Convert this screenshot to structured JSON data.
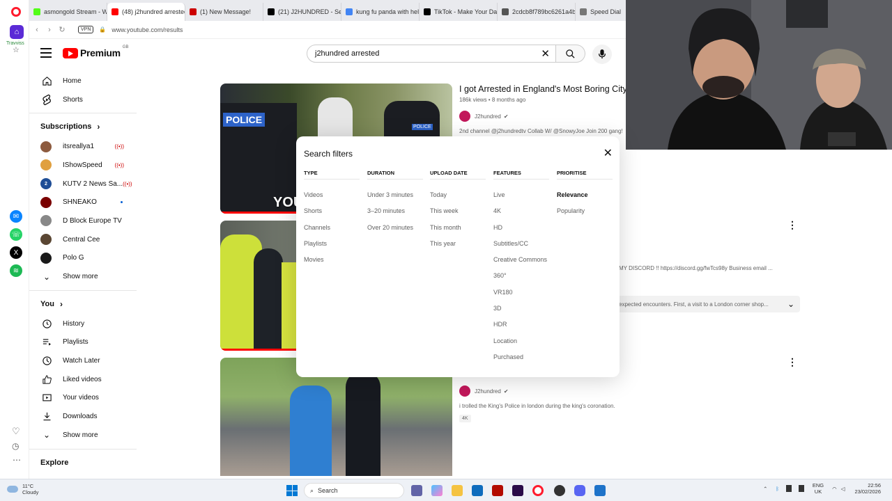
{
  "tabs": [
    {
      "label": "asmongold Stream - Watc",
      "color": "#53fc18"
    },
    {
      "label": "(48) j2hundred arrested -",
      "color": "#ff0000",
      "active": true
    },
    {
      "label": "(1) New Message!",
      "color": "#cc0000"
    },
    {
      "label": "(21) J2HUNDRED - Search",
      "color": "#000000"
    },
    {
      "label": "kung fu panda with helme",
      "color": "#4285f4"
    },
    {
      "label": "TikTok - Make Your Day",
      "color": "#000000"
    },
    {
      "label": "2cdcb8f789bc6261a4ba2",
      "color": "#555555"
    },
    {
      "label": "Speed Dial",
      "color": "#777777"
    }
  ],
  "browser": {
    "url_host": "www.youtube.com",
    "url_path": "/results",
    "vpn_label": "VPN",
    "sidebar_top_label": "Travviss"
  },
  "youtube": {
    "logo_text": "Premium",
    "region": "GB",
    "search_value": "j2hundred arrested"
  },
  "guide": {
    "main": [
      {
        "label": "Home",
        "icon": "home-icon"
      },
      {
        "label": "Shorts",
        "icon": "shorts-icon"
      }
    ],
    "subscriptions_title": "Subscriptions",
    "subscriptions": [
      {
        "label": "itsreallya1",
        "status": "live",
        "color": "#8d5b3f"
      },
      {
        "label": "IShowSpeed",
        "status": "live",
        "color": "#e0a040"
      },
      {
        "label": "KUTV 2 News Sa...",
        "status": "live",
        "color": "#1f4e96",
        "badge": "2"
      },
      {
        "label": "SHNEAKO",
        "status": "new",
        "color": "#7a0000"
      },
      {
        "label": "D Block Europe TV",
        "status": "",
        "color": "#888888"
      },
      {
        "label": "Central Cee",
        "status": "",
        "color": "#5a4633"
      },
      {
        "label": "Polo G",
        "status": "",
        "color": "#1a1a1a"
      }
    ],
    "show_more_1": "Show more",
    "you_title": "You",
    "you_items": [
      {
        "label": "History",
        "icon": "history-icon"
      },
      {
        "label": "Playlists",
        "icon": "playlists-icon"
      },
      {
        "label": "Watch Later",
        "icon": "watch-later-icon"
      },
      {
        "label": "Liked videos",
        "icon": "thumbs-up-icon"
      },
      {
        "label": "Your videos",
        "icon": "your-videos-icon"
      },
      {
        "label": "Downloads",
        "icon": "download-icon"
      }
    ],
    "show_more_2": "Show more",
    "explore_title": "Explore"
  },
  "results": [
    {
      "title": "I got Arrested in England's Most Boring City!",
      "meta": "186k views • 8 months ago",
      "channel": "J2hundred",
      "desc": "2nd channel @j2hundredtv Collab W/ @SnowyJoe Join 200 gang!",
      "thumb_text_1": "POLICE",
      "thumb_text_2": "POLICE",
      "thumb_text_3": "YOU"
    },
    {
      "desc_partial": "MY DISCORD !! https://discord.gg/fwTcs98y Business email ...",
      "chapters_partial": "expected encounters. First, a visit to a London corner shop..."
    },
    {
      "channel": "J2hundred",
      "desc": "i trolled the King's Police in london during the king's coronation.",
      "badge": "4K"
    }
  ],
  "filters": {
    "title": "Search filters",
    "columns": [
      {
        "header": "Type",
        "options": [
          "Videos",
          "Shorts",
          "Channels",
          "Playlists",
          "Movies"
        ]
      },
      {
        "header": "Duration",
        "options": [
          "Under 3 minutes",
          "3–20 minutes",
          "Over 20 minutes"
        ]
      },
      {
        "header": "Upload date",
        "options": [
          "Today",
          "This week",
          "This month",
          "This year"
        ]
      },
      {
        "header": "Features",
        "options": [
          "Live",
          "4K",
          "HD",
          "Subtitles/CC",
          "Creative Commons",
          "360°",
          "VR180",
          "3D",
          "HDR",
          "Location",
          "Purchased"
        ]
      },
      {
        "header": "Prioritise",
        "options": [
          "Relevance",
          "Popularity"
        ],
        "selected": "Relevance"
      }
    ]
  },
  "taskbar": {
    "temp": "11°C",
    "weather": "Cloudy",
    "search_placeholder": "Search",
    "lang_1": "ENG",
    "lang_2": "UK",
    "time": "22:56",
    "date": "23/02/2026"
  }
}
